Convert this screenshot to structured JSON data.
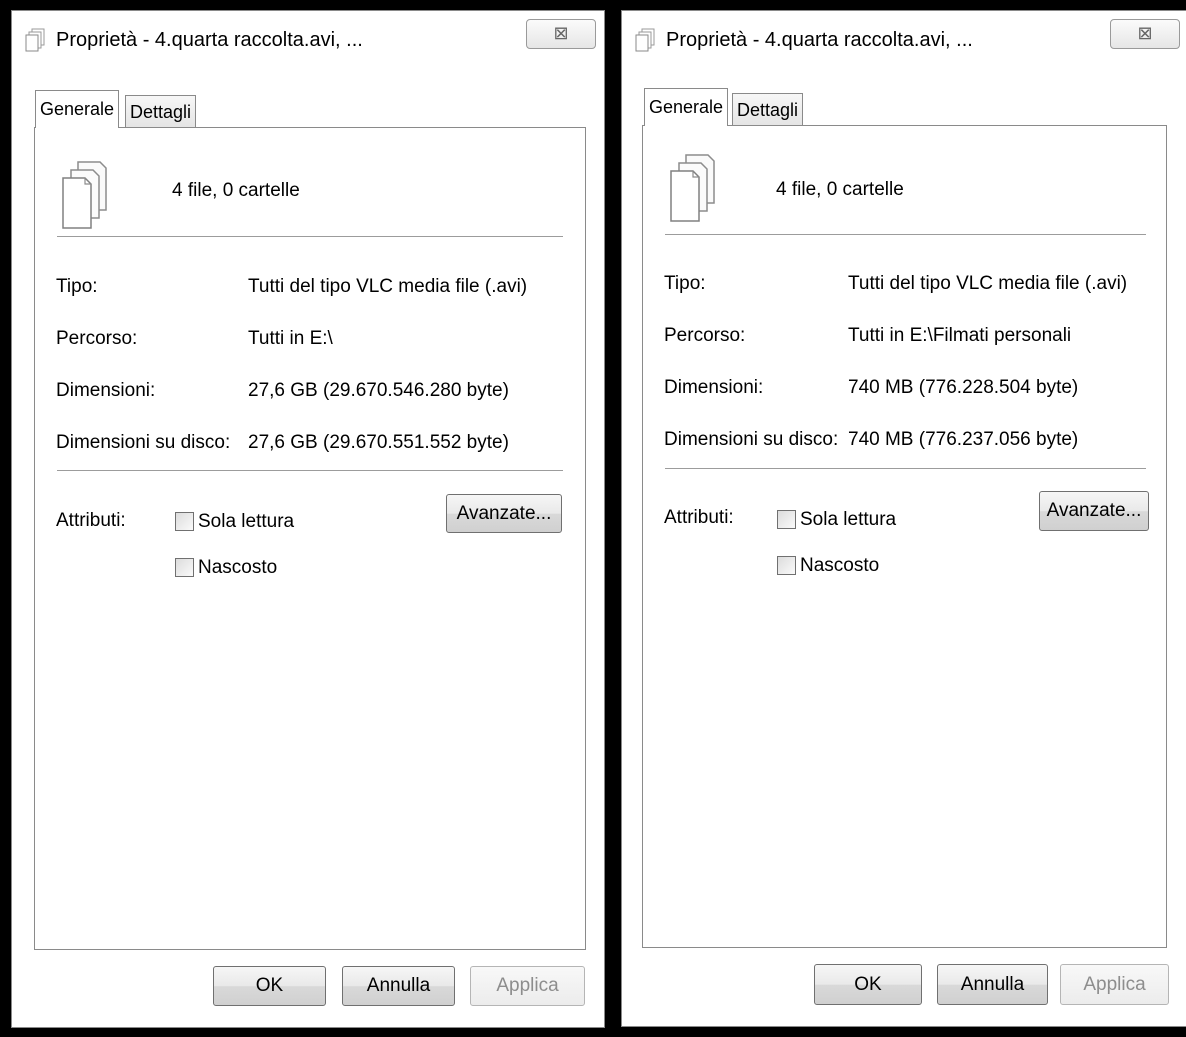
{
  "dialogs": [
    {
      "title": "Proprietà - 4.quarta raccolta.avi, ...",
      "close_glyph": "⊠",
      "tabs": [
        "Generale",
        "Dettagli"
      ],
      "summary": "4 file, 0 cartelle",
      "fields": [
        {
          "label": "Tipo:",
          "value": "Tutti del tipo VLC media file (.avi)"
        },
        {
          "label": "Percorso:",
          "value": "Tutti in E:\\"
        },
        {
          "label": "Dimensioni:",
          "value": "27,6 GB (29.670.546.280 byte)"
        },
        {
          "label": "Dimensioni su disco:",
          "value": "27,6 GB (29.670.551.552 byte)"
        }
      ],
      "attributes_label": "Attributi:",
      "readonly_label": "Sola lettura",
      "hidden_label": "Nascosto",
      "advanced_button": "Avanzate...",
      "ok_button": "OK",
      "cancel_button": "Annulla",
      "apply_button": "Applica"
    },
    {
      "title": "Proprietà - 4.quarta raccolta.avi, ...",
      "close_glyph": "⊠",
      "tabs": [
        "Generale",
        "Dettagli"
      ],
      "summary": "4 file, 0 cartelle",
      "fields": [
        {
          "label": "Tipo:",
          "value": "Tutti del tipo VLC media file (.avi)"
        },
        {
          "label": "Percorso:",
          "value": "Tutti in E:\\Filmati personali"
        },
        {
          "label": "Dimensioni:",
          "value": "740 MB (776.228.504 byte)"
        },
        {
          "label": "Dimensioni su disco:",
          "value": "740 MB (776.237.056 byte)"
        }
      ],
      "attributes_label": "Attributi:",
      "readonly_label": "Sola lettura",
      "hidden_label": "Nascosto",
      "advanced_button": "Avanzate...",
      "ok_button": "OK",
      "cancel_button": "Annulla",
      "apply_button": "Applica"
    }
  ]
}
